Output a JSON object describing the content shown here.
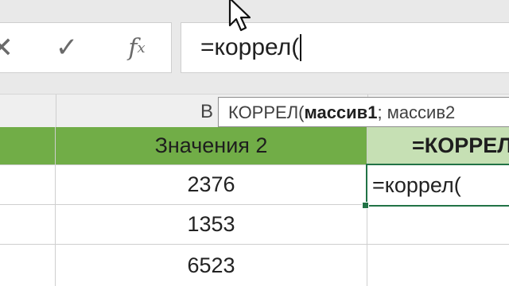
{
  "formula_bar": {
    "cancel_glyph": "✕",
    "enter_glyph": "✓",
    "fx_label": "f",
    "fx_sub": "x",
    "formula": "=коррел("
  },
  "columns": {
    "b_label": "B"
  },
  "tooltip": {
    "function": "КОРРЕЛ(",
    "arg1": "массив1",
    "separator": "; ",
    "arg2": "массив2"
  },
  "table": {
    "col_b_header": "Значения 2",
    "col_c_header": "=КОРРЕЛ",
    "values_b": [
      "2376",
      "1353",
      "6523"
    ],
    "active_cell_text": "=коррел("
  },
  "colors": {
    "header_green": "#71ad47",
    "header_light_green": "#c6e0b4",
    "active_border": "#217346"
  }
}
